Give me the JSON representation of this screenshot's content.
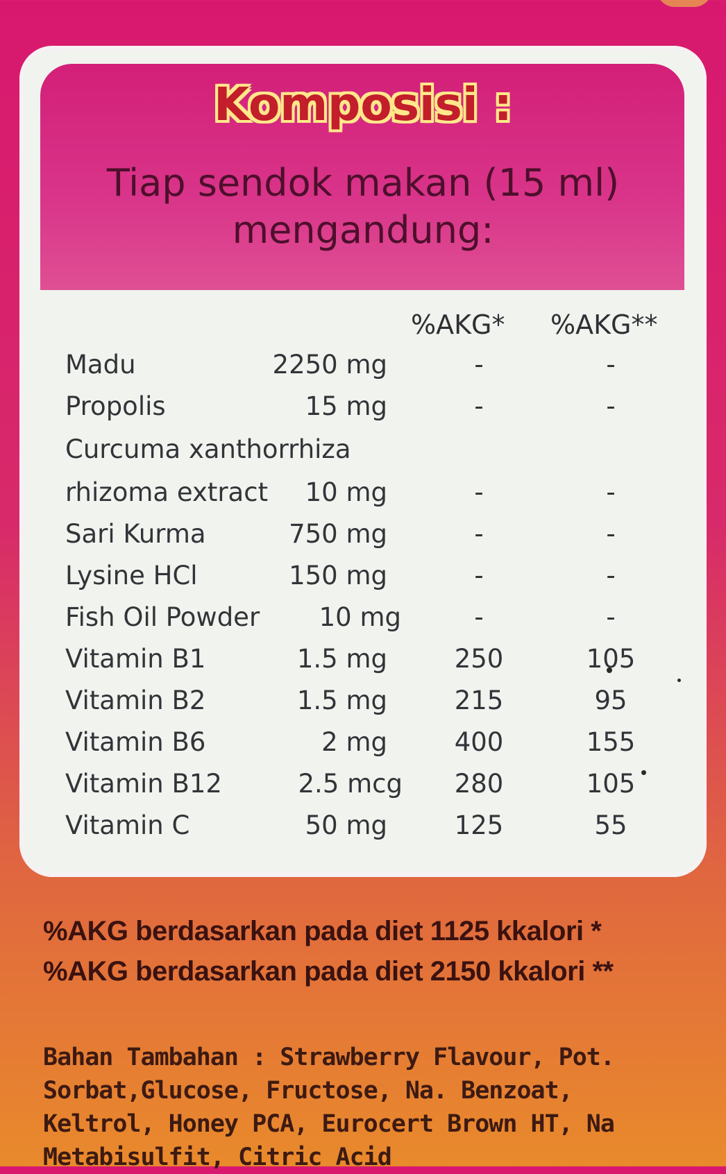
{
  "title": "Komposisi :",
  "subtitle_line1": "Tiap sendok makan (15 ml)",
  "subtitle_line2": "mengandung:",
  "columns": {
    "akg1": "%AKG*",
    "akg2": "%AKG**"
  },
  "rows": [
    {
      "name": "Madu",
      "amount": "2250 mg",
      "akg1": "-",
      "akg2": "-"
    },
    {
      "name": "Propolis",
      "amount": "15 mg",
      "akg1": "-",
      "akg2": "-"
    },
    {
      "name": "Curcuma xanthorrhiza",
      "amount": "",
      "akg1": "",
      "akg2": ""
    },
    {
      "name": "rhizoma extract",
      "amount": "10 mg",
      "akg1": "-",
      "akg2": "-"
    },
    {
      "name": "Sari Kurma",
      "amount": "750 mg",
      "akg1": "-",
      "akg2": "-"
    },
    {
      "name": "Lysine HCl",
      "amount": "150 mg",
      "akg1": "-",
      "akg2": "-"
    },
    {
      "name": "Fish Oil Powder",
      "amount": "10 mg",
      "akg1": "-",
      "akg2": "-"
    },
    {
      "name": "Vitamin B1",
      "amount": "1.5 mg",
      "akg1": "250",
      "akg2": "105"
    },
    {
      "name": "Vitamin B2",
      "amount": "1.5 mg",
      "akg1": "215",
      "akg2": "95"
    },
    {
      "name": "Vitamin B6",
      "amount": "2 mg",
      "akg1": "400",
      "akg2": "155"
    },
    {
      "name": "Vitamin B12",
      "amount": "2.5 mcg",
      "akg1": "280",
      "akg2": "105"
    },
    {
      "name": "Vitamin C",
      "amount": "50 mg",
      "akg1": "125",
      "akg2": "55"
    }
  ],
  "footnote1": "%AKG berdasarkan pada diet 1125 kkalori *",
  "footnote2": "%AKG berdasarkan pada diet 2150 kkalori **",
  "additives": "Bahan Tambahan : Strawberry Flavour, Pot. Sorbat,Glucose, Fructose, Na. Benzoat, Keltrol, Honey PCA, Eurocert Brown HT, Na Metabisulfit, Citric Acid",
  "colors": {
    "background_top": "#d8186f",
    "background_bottom": "#e98a2c",
    "panel": "#f1f3ef",
    "header_band": "#d31f78",
    "title_text": "#c21e2b",
    "title_outline": "#ffe88a",
    "table_text": "#333338"
  }
}
